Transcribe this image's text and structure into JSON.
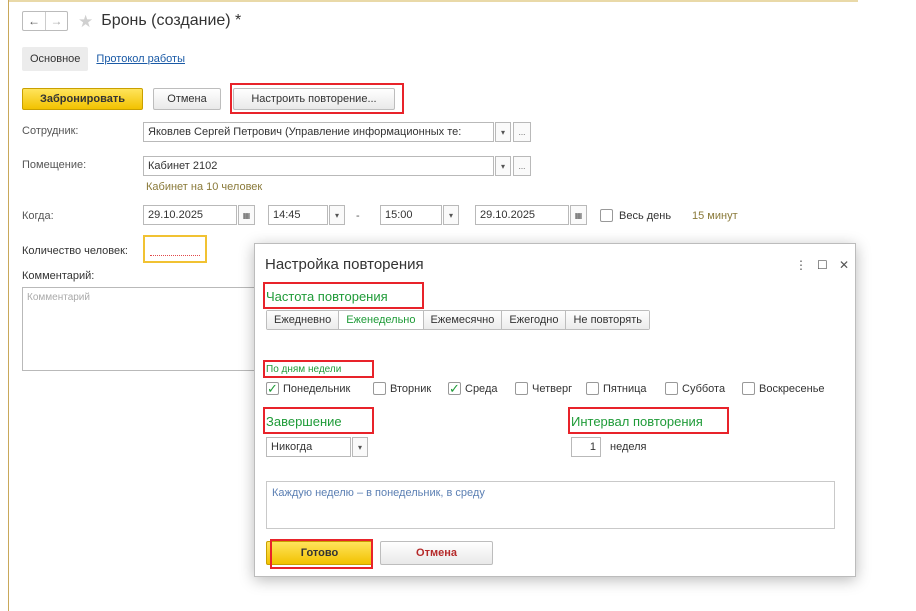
{
  "window": {
    "title": "Бронь (создание) *",
    "back_glyph": "←",
    "forward_glyph": "→",
    "star_glyph": "★"
  },
  "tabs": {
    "main": "Основное",
    "log": "Протокол работы"
  },
  "toolbar": {
    "book": "Забронировать",
    "cancel": "Отмена",
    "repeat": "Настроить повторение..."
  },
  "form": {
    "employee_label": "Сотрудник:",
    "employee_value": "Яковлев Сергей Петрович (Управление информационных те:",
    "room_label": "Помещение:",
    "room_value": "Кабинет 2102",
    "room_hint": "Кабинет на 10 человек",
    "when_label": "Когда:",
    "date_from": "29.10.2025",
    "time_from": "14:45",
    "dash": "-",
    "time_to": "15:00",
    "date_to": "29.10.2025",
    "all_day": "Весь день",
    "duration": "15 минут",
    "people_label": "Количество человек:",
    "comment_label": "Комментарий:",
    "comment_placeholder": "Комментарий"
  },
  "icons": {
    "dropdown": "▾",
    "more": "...",
    "calendar": "▦"
  },
  "dialog": {
    "title": "Настройка повторения",
    "menu_glyph": "⋮",
    "max_glyph": "☐",
    "close_glyph": "✕",
    "frequency_heading": "Частота повторения",
    "frequency_options": [
      "Ежедневно",
      "Еженедельно",
      "Ежемесячно",
      "Ежегодно"
    ],
    "frequency_selected": "Еженедельно",
    "no_repeat": "Не повторять",
    "weekdays_heading": "По дням недели",
    "weekdays": [
      {
        "label": "Понедельник",
        "checked": true
      },
      {
        "label": "Вторник",
        "checked": false
      },
      {
        "label": "Среда",
        "checked": true
      },
      {
        "label": "Четверг",
        "checked": false
      },
      {
        "label": "Пятница",
        "checked": false
      },
      {
        "label": "Суббота",
        "checked": false
      },
      {
        "label": "Воскресенье",
        "checked": false
      }
    ],
    "check_glyph": "✓",
    "ending_heading": "Завершение",
    "ending_value": "Никогда",
    "interval_heading": "Интервал повторения",
    "interval_value": "1",
    "interval_unit": "неделя",
    "summary": "Каждую неделю – в понедельник, в среду",
    "ok": "Готово",
    "cancel": "Отмена"
  },
  "colors": {
    "accent_green": "#1f9b38",
    "primary_yellow": "#f2c200",
    "highlight_red": "#e8232a",
    "link_blue": "#1a5aa6"
  }
}
